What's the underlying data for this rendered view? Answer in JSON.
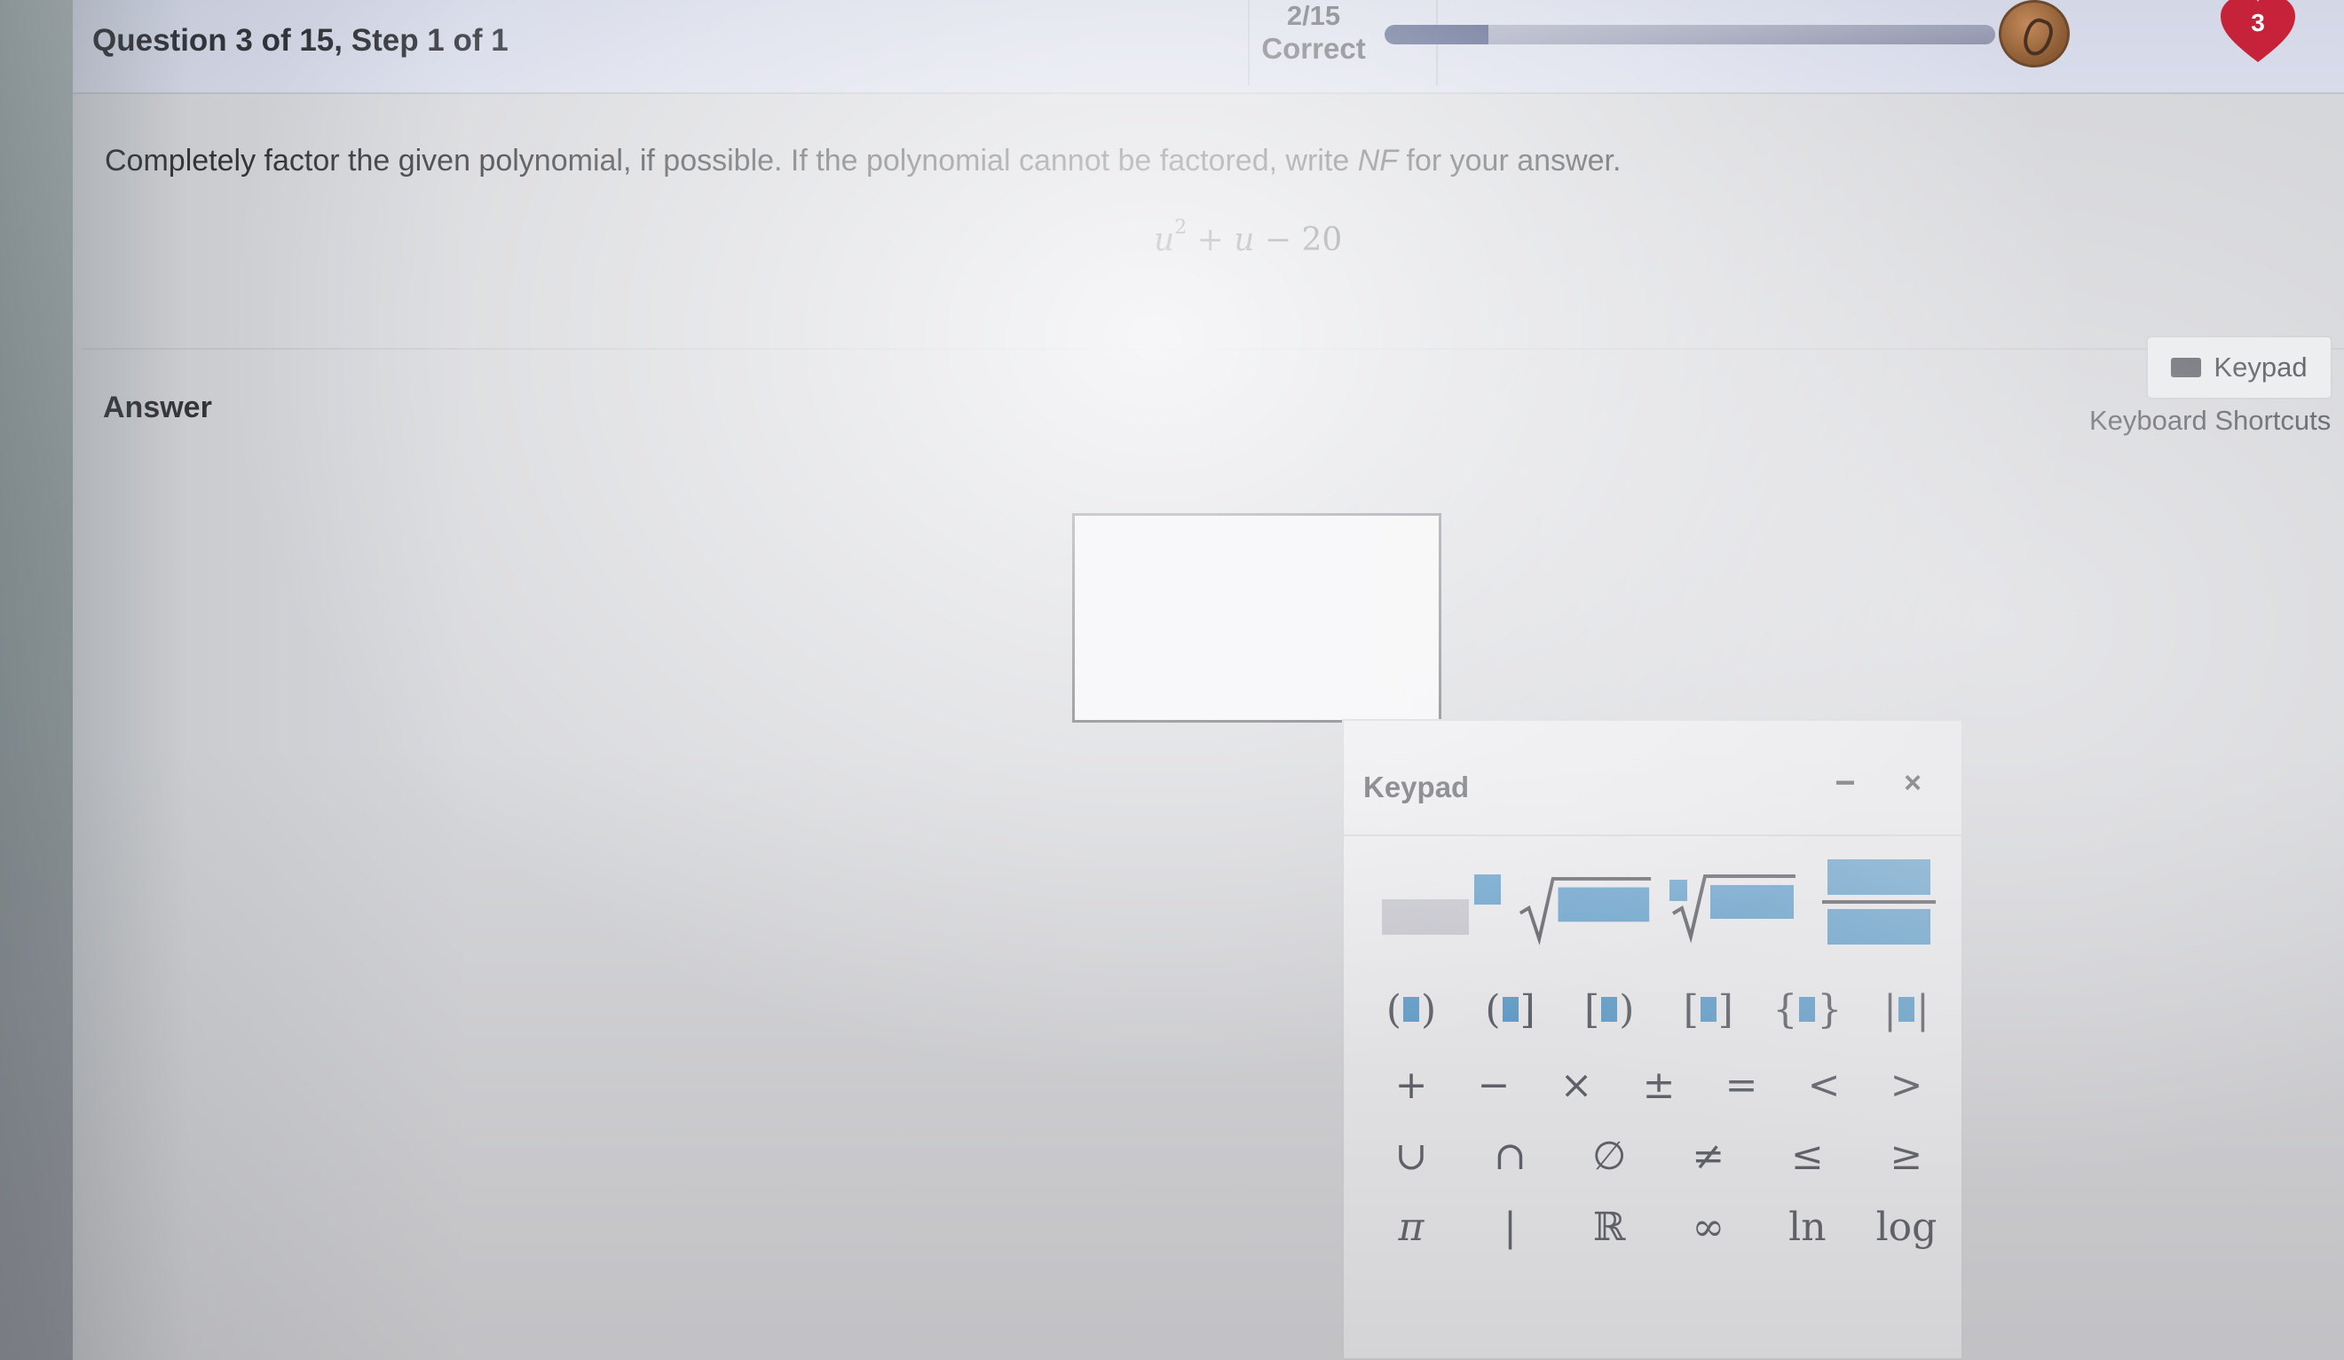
{
  "header": {
    "question_title": "Question 3 of 15, Step 1 of 1",
    "score_fraction": "2/15",
    "score_label": "Correct",
    "progress": 0.17,
    "lives": "3",
    "icons": [
      "trophy-icon",
      "heart-icon"
    ],
    "colors": {
      "progress_fill": "#2f3d6e",
      "heart": "#c6233b"
    }
  },
  "question": {
    "prompt_before": "Completely factor the given polynomial, if possible. If the polynomial cannot be factored, write ",
    "prompt_nf": "NF",
    "prompt_after": " for your answer.",
    "expression": {
      "var1": "u",
      "exp": "2",
      "op1": " + ",
      "var2": "u",
      "op2": " − ",
      "const": "20"
    }
  },
  "answer": {
    "label": "Answer",
    "keypad_button": "Keypad",
    "shortcuts_link": "Keyboard Shortcuts",
    "value": ""
  },
  "keypad": {
    "title": "Keypad",
    "minimize": "−",
    "close": "×",
    "row1": [
      "superscript",
      "square-root",
      "nth-root",
      "fraction"
    ],
    "row2": [
      "parentheses",
      "open-closed-interval",
      "closed-open-interval",
      "closed-interval",
      "braces",
      "absolute-value"
    ],
    "row3": [
      "+",
      "−",
      "×",
      "±",
      "=",
      "<",
      ">"
    ],
    "row4": [
      "∪",
      "∩",
      "∅",
      "≠",
      "≤",
      "≥"
    ],
    "row5": [
      "π",
      "|",
      "ℝ",
      "∞",
      "ln",
      "log"
    ]
  }
}
